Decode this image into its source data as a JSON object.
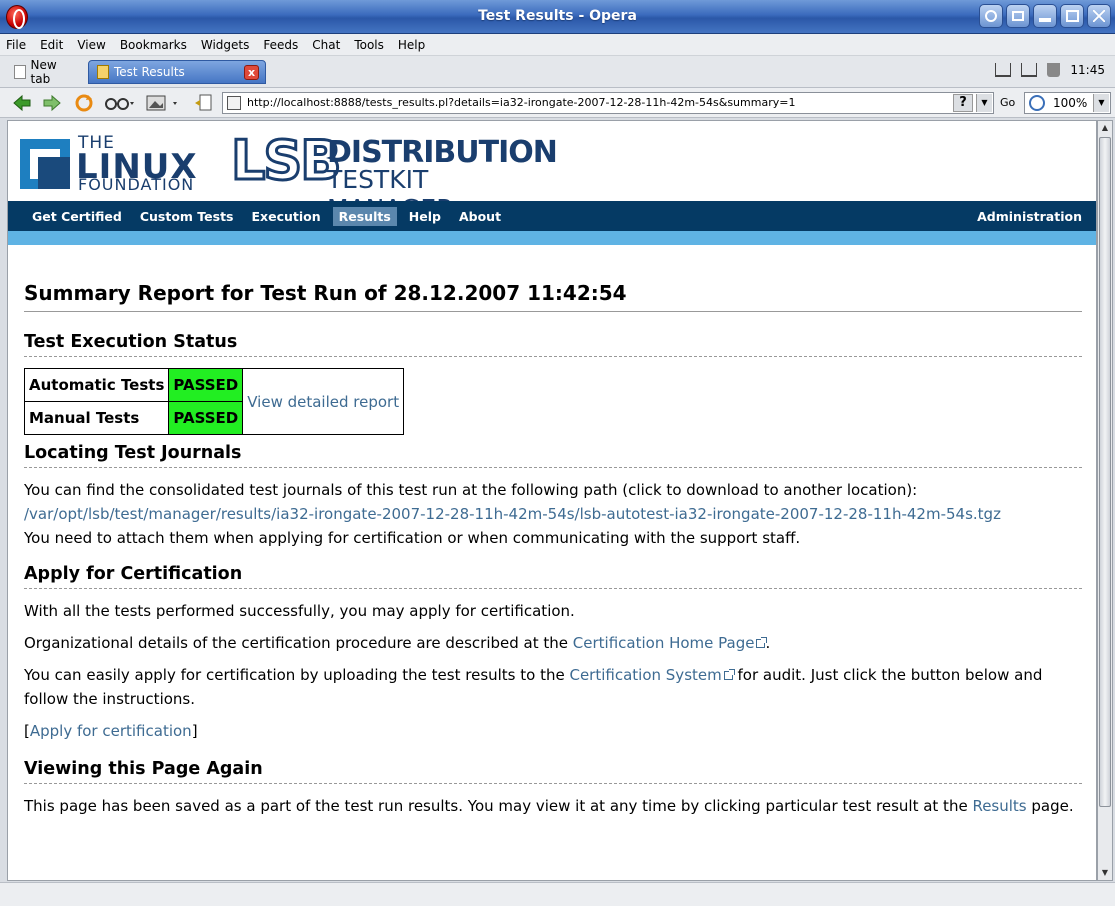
{
  "window": {
    "title": "Test Results - Opera"
  },
  "menu": [
    "File",
    "Edit",
    "View",
    "Bookmarks",
    "Widgets",
    "Feeds",
    "Chat",
    "Tools",
    "Help"
  ],
  "tabs": {
    "new_tab": "New tab",
    "active_tab": "Test Results",
    "close": "x"
  },
  "tray": {
    "clock": "11:45"
  },
  "toolbar": {
    "url": "http://localhost:8888/tests_results.pl?details=ia32-irongate-2007-12-28-11h-42m-54s&summary=1",
    "help_symbol": "?",
    "go_label": "Go",
    "zoom": "100%"
  },
  "header": {
    "lf_the": "THE",
    "lf_linux": "LINUX",
    "lf_foundation": "FOUNDATION",
    "lsb": "LSB",
    "distribution": "DISTRIBUTION",
    "testkit_manager": "TESTKIT MANAGER"
  },
  "nav": {
    "items": [
      "Get Certified",
      "Custom Tests",
      "Execution",
      "Results",
      "Help",
      "About"
    ],
    "admin": "Administration"
  },
  "page": {
    "title": "Summary Report for Test Run of 28.12.2007 11:42:54",
    "status": {
      "heading": "Test Execution Status",
      "automatic_label": "Automatic Tests",
      "automatic_value": "PASSED",
      "manual_label": "Manual Tests",
      "manual_value": "PASSED",
      "detailed_link": "View detailed report"
    },
    "journals": {
      "heading": "Locating Test Journals",
      "intro": "You can find the consolidated test journals of this test run at the following path (click to download to another location):",
      "path": "/var/opt/lsb/test/manager/results/ia32-irongate-2007-12-28-11h-42m-54s/lsb-autotest-ia32-irongate-2007-12-28-11h-42m-54s.tgz",
      "note": "You need to attach them when applying for certification or when communicating with the support staff."
    },
    "certification": {
      "heading": "Apply for Certification",
      "p1": "With all the tests performed successfully, you may apply for certification.",
      "p2_before": "Organizational details of the certification procedure are described at the ",
      "p2_link": "Certification Home Page",
      "p2_after": ".",
      "p3_before": "You can easily apply for certification by uploading the test results to the ",
      "p3_link": "Certification System",
      "p3_after": " for audit. Just click the button below and follow the instructions.",
      "apply_open": "[",
      "apply_link": "Apply for certification",
      "apply_close": "]"
    },
    "viewing": {
      "heading": "Viewing this Page Again",
      "text_before": "This page has been saved as a part of the test run results. You may view it at any time by clicking particular test result at the ",
      "link": "Results",
      "text_after": " page."
    }
  },
  "colors": {
    "nav_bg": "#053a64",
    "stripe": "#5fb3e4",
    "passed": "#22ee22",
    "link": "#3e6b92"
  }
}
